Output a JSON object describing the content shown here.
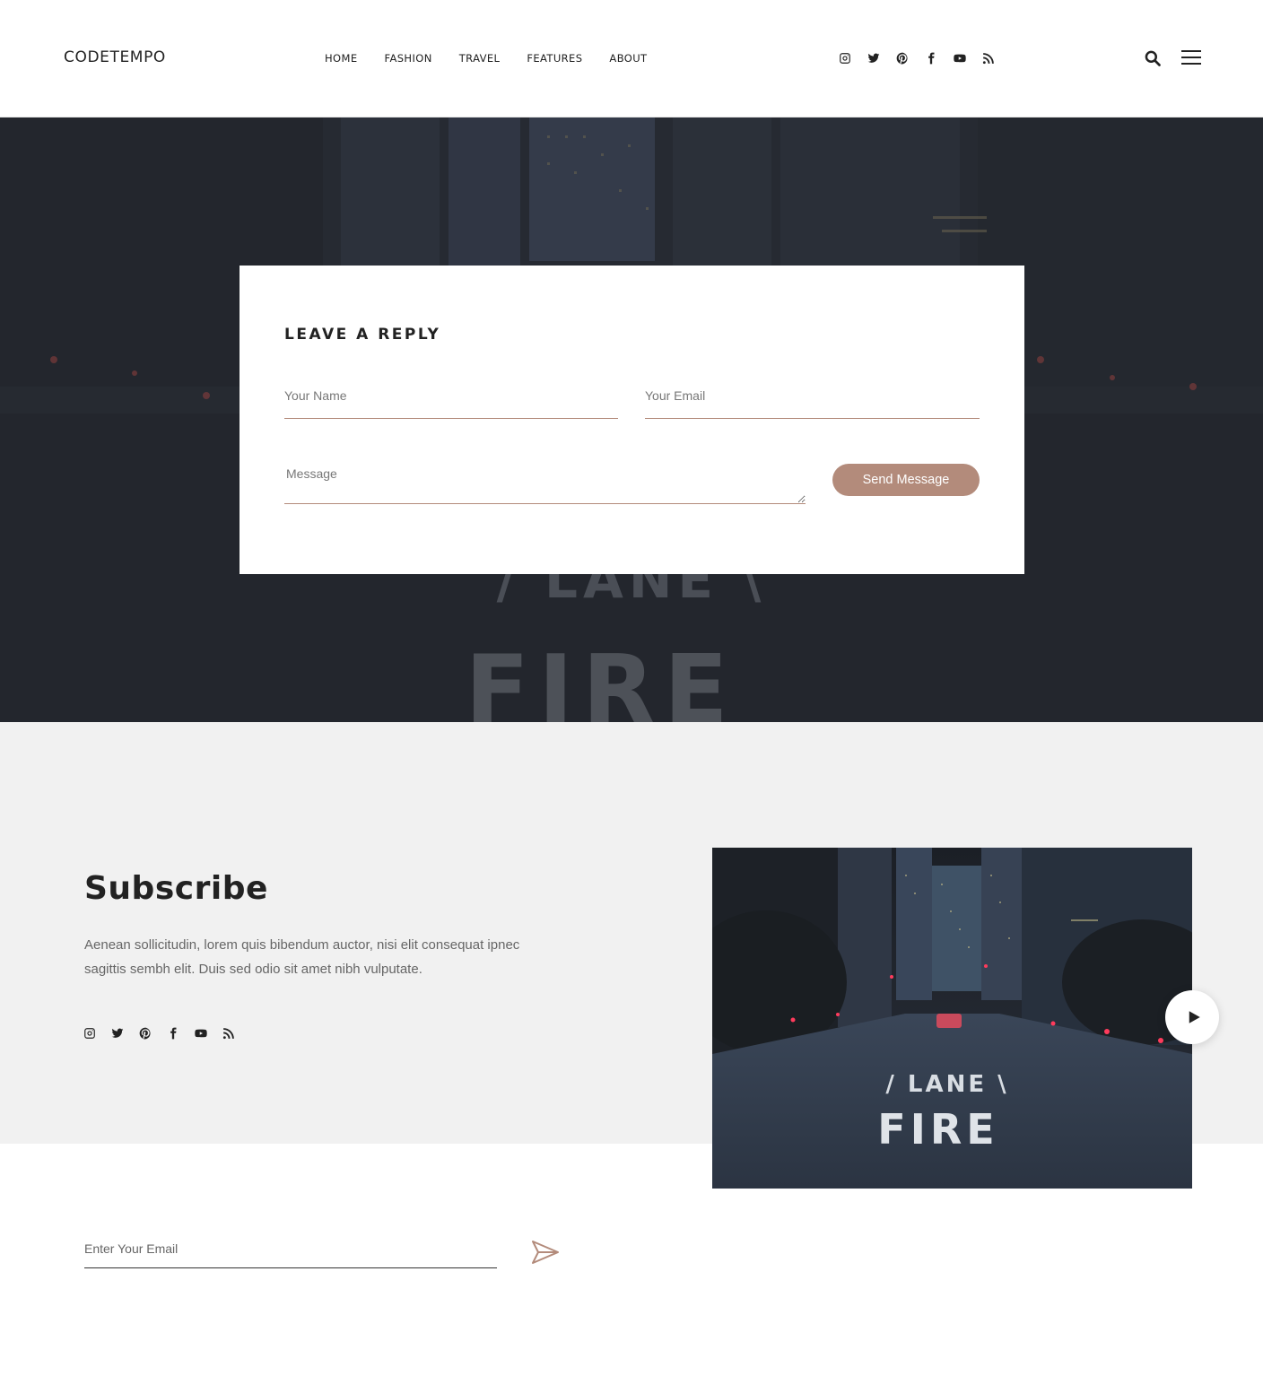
{
  "header": {
    "logo": "CODETEMPO",
    "nav": [
      "HOME",
      "FASHION",
      "TRAVEL",
      "FEATURES",
      "ABOUT"
    ],
    "social_icons": [
      "instagram-icon",
      "twitter-icon",
      "pinterest-icon",
      "facebook-icon",
      "youtube-icon",
      "rss-icon"
    ],
    "search_icon": "search-icon",
    "menu_icon": "hamburger-menu-icon"
  },
  "hero": {
    "road_text_1": "/ LANE \\",
    "road_text_2": "FIRE"
  },
  "reply": {
    "title": "LEAVE A REPLY",
    "name_placeholder": "Your Name",
    "email_placeholder": "Your Email",
    "message_placeholder": "Message",
    "send_label": "Send Message"
  },
  "subscribe": {
    "title": "Subscribe",
    "text": "Aenean sollicitudin, lorem quis bibendum auctor, nisi elit consequat ipnec sagittis sembh elit. Duis sed odio sit amet nibh vulputate.",
    "social_icons": [
      "instagram-icon",
      "twitter-icon",
      "pinterest-icon",
      "facebook-icon",
      "youtube-icon",
      "rss-icon"
    ],
    "email_placeholder": "Enter Your Email",
    "play_icon": "play-icon",
    "send_icon": "paper-plane-icon"
  },
  "colors": {
    "accent": "#b38b7b",
    "band": "#f1f1f1",
    "dark": "#222222"
  }
}
